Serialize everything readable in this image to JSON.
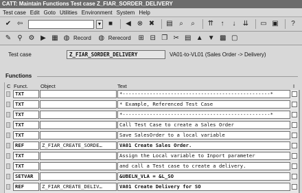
{
  "window": {
    "title": "CATT: Maintain Functions Test case Z_FIAR_SORDER_DELIVERY"
  },
  "menu": [
    "Test case",
    "Edit",
    "Goto",
    "Utilities",
    "Environment",
    "System",
    "Help"
  ],
  "toolbar": {
    "record_label": "Record",
    "rerecord_label": "Rerecord"
  },
  "header": {
    "test_case_label": "Test case",
    "test_case_value": "Z_FIAR_SORDER_DELIVERY",
    "test_case_desc": "VA01-to-VL01 (Sales Order -> Delivery)"
  },
  "functions": {
    "section_label": "Functions",
    "columns": {
      "c": "C",
      "funct": "Funct.",
      "object": "Object",
      "text": "Text",
      "i": "I"
    },
    "rows": [
      {
        "funct": "TXT",
        "object": "",
        "text": "*-------------------------------------------------*"
      },
      {
        "funct": "TXT",
        "object": "",
        "text": "* Example, Referenced Test Case"
      },
      {
        "funct": "TXT",
        "object": "",
        "text": "*-------------------------------------------------*"
      },
      {
        "funct": "TXT",
        "object": "",
        "text": "Call Test Case to create a Sales Order"
      },
      {
        "funct": "TXT",
        "object": "",
        "text": "Save SalesOrder to a local variable"
      },
      {
        "funct": "REF",
        "object": "Z_FIAR_CREATE_SORDE…",
        "text": "VA01 Create Sales Order."
      },
      {
        "funct": "TXT",
        "object": "",
        "text": "Assign the Local variable to Inport parameter"
      },
      {
        "funct": "TXT",
        "object": "",
        "text": "and call a Test case to create a delivery."
      },
      {
        "funct": "SETVAR",
        "object": "",
        "text": "&UBELN_VLA = &L_SO"
      },
      {
        "funct": "REF",
        "object": "Z_FIAR_CREATE_DELIV…",
        "text": "VA01 Create Delivery for SO"
      }
    ]
  }
}
